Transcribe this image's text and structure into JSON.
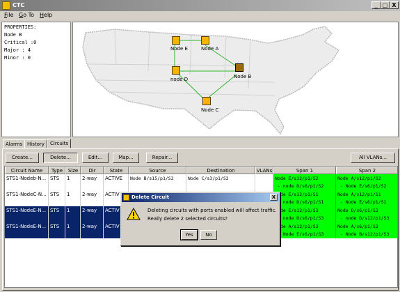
{
  "window": {
    "title": "CTC",
    "min": "_",
    "max": "□",
    "close": "X"
  },
  "menu": [
    {
      "label": "File",
      "u": "F",
      "rest": "ile"
    },
    {
      "label": "Go To",
      "u": "G",
      "rest": "o To"
    },
    {
      "label": "Help",
      "u": "H",
      "rest": "elp"
    }
  ],
  "properties": {
    "heading": "PROPERTIES:",
    "lines": [
      "Node B",
      "Critical :0",
      "Major : 4",
      "Minor : 0"
    ]
  },
  "map": {
    "nodes": [
      "Node E",
      "Node A",
      "node D",
      "Node B",
      "Node C"
    ],
    "selected_node": "Node B",
    "link_color": "#2fb52f"
  },
  "tabs": [
    "Alarms",
    "History",
    "Circuits"
  ],
  "active_tab": "Circuits",
  "toolbar": {
    "create": "Create...",
    "delete": "Delete...",
    "edit": "Edit...",
    "map": "Map...",
    "repair": "Repair...",
    "all_vlans": "All VLANs..."
  },
  "table": {
    "columns": [
      "Circuit Name",
      "Type",
      "Size",
      "Dir",
      "State",
      "Source",
      "Destination",
      "VLANs",
      "Span 1",
      "Span 2"
    ],
    "rows": [
      {
        "name": "STS1-Nodeb-N...",
        "type": "STS",
        "size": "1",
        "dir": "2-way",
        "state": "ACTIVE",
        "source": "Node B/s15/p1/S2",
        "destination": "Node C/s3/p1/S2",
        "vlans": "",
        "span1": [
          "Node E/s12/p1/S2",
          " - node D/s6/p1/S2"
        ],
        "span2": [
          "Node A/s12/p1/S2",
          " - Node E/s6/p1/S2"
        ],
        "selected": false
      },
      {
        "name": "STS1-NodeC-N...",
        "type": "STS",
        "size": "1",
        "dir": "2-way",
        "state": "ACTIV",
        "source": "",
        "destination": "",
        "vlans": "",
        "span1": [
          "Node E/s12/p1/S1",
          " - node D/s6/p1/S1"
        ],
        "span2": [
          "Node A/s12/p1/S1",
          " - Node E/s6/p1/S1"
        ],
        "selected": false
      },
      {
        "name": "STS1-NodeE-N...",
        "type": "STS",
        "size": "1",
        "dir": "2-way",
        "state": "ACTIV",
        "source": "",
        "destination": "",
        "vlans": "",
        "span1": [
          "Node E/s12/p1/S3",
          " - node D/s6/p1/S3"
        ],
        "span2": [
          "Node D/s6/p1/S3",
          " - node D/s12/p1/S3"
        ],
        "selected": true
      },
      {
        "name": "STS1-NodeE-N...",
        "type": "STS",
        "size": "1",
        "dir": "2-way",
        "state": "ACTIV",
        "source": "",
        "destination": "",
        "vlans": "",
        "span1": [
          "Node A/s12/p1/S3",
          " - Node E/s6/p1/S3"
        ],
        "span2": [
          "Node A/s6/p1/S3",
          " - Node B/s12/p1/S3"
        ],
        "selected": true
      }
    ]
  },
  "dialog": {
    "title": "Delete Circuit",
    "close": "X",
    "message1": "Deleting circuits with ports enabled will affect traffic.",
    "message2": "Really delete 2 selected circuits?",
    "yes": "Yes",
    "no": "No"
  }
}
